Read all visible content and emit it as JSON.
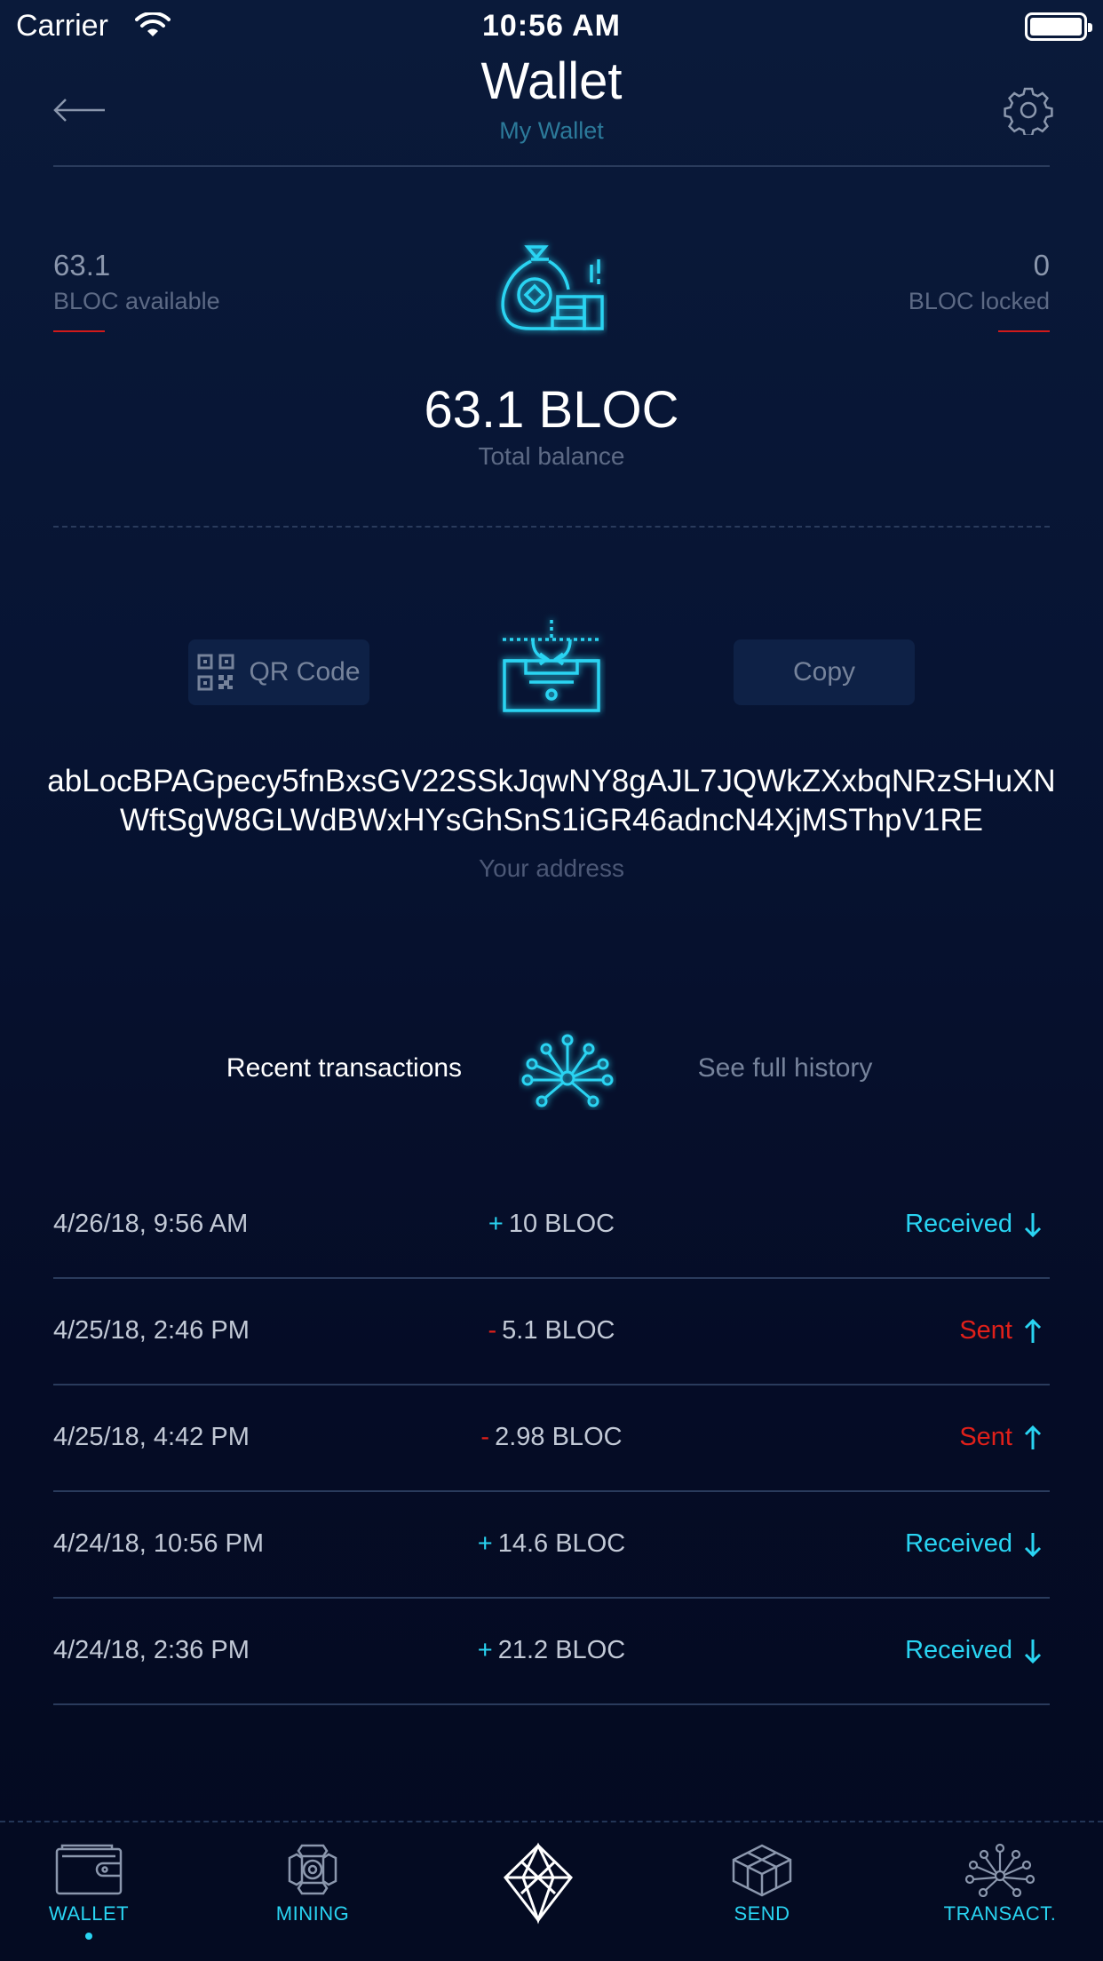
{
  "status_bar": {
    "carrier": "Carrier",
    "time": "10:56 AM"
  },
  "header": {
    "title": "Wallet",
    "subtitle": "My Wallet"
  },
  "balance": {
    "available_value": "63.1",
    "available_label": "BLOC available",
    "locked_value": "0",
    "locked_label": "BLOC locked",
    "total": "63.1 BLOC",
    "total_label": "Total balance"
  },
  "address_section": {
    "qr_button_label": "QR Code",
    "copy_button_label": "Copy",
    "address": "abLocBPAGpecy5fnBxsGV22SSkJqwNY8gAJL7JQWkZXxbqNRzSHuXNWftSgW8GLWdBWxHYsGhSnS1iGR46adncN4XjMSThpV1RE",
    "address_label": "Your address"
  },
  "recent": {
    "title": "Recent transactions",
    "history_link": "See full history"
  },
  "transactions": [
    {
      "date": "4/26/18, 9:56 AM",
      "sign": "+",
      "amount": "10 BLOC",
      "status": "Received",
      "direction": "down"
    },
    {
      "date": "4/25/18, 2:46 PM",
      "sign": "-",
      "amount": "5.1 BLOC",
      "status": "Sent",
      "direction": "up"
    },
    {
      "date": "4/25/18, 4:42 PM",
      "sign": "-",
      "amount": "2.98 BLOC",
      "status": "Sent",
      "direction": "up"
    },
    {
      "date": "4/24/18, 10:56 PM",
      "sign": "+",
      "amount": "14.6 BLOC",
      "status": "Received",
      "direction": "down"
    },
    {
      "date": "4/24/18, 2:36 PM",
      "sign": "+",
      "amount": "21.2 BLOC",
      "status": "Received",
      "direction": "down"
    }
  ],
  "tabs": {
    "wallet": "WALLET",
    "mining": "MINING",
    "send": "SEND",
    "transactions": "TRANSACT."
  },
  "colors": {
    "accent": "#29d4f2",
    "sent": "#e0201a",
    "background": "#071433"
  },
  "icons": {
    "back": "arrow-left-icon",
    "settings": "gear-icon",
    "balance": "money-bag-icon",
    "qr": "qr-code-icon",
    "receive": "inbox-icon",
    "recent": "network-icon"
  }
}
